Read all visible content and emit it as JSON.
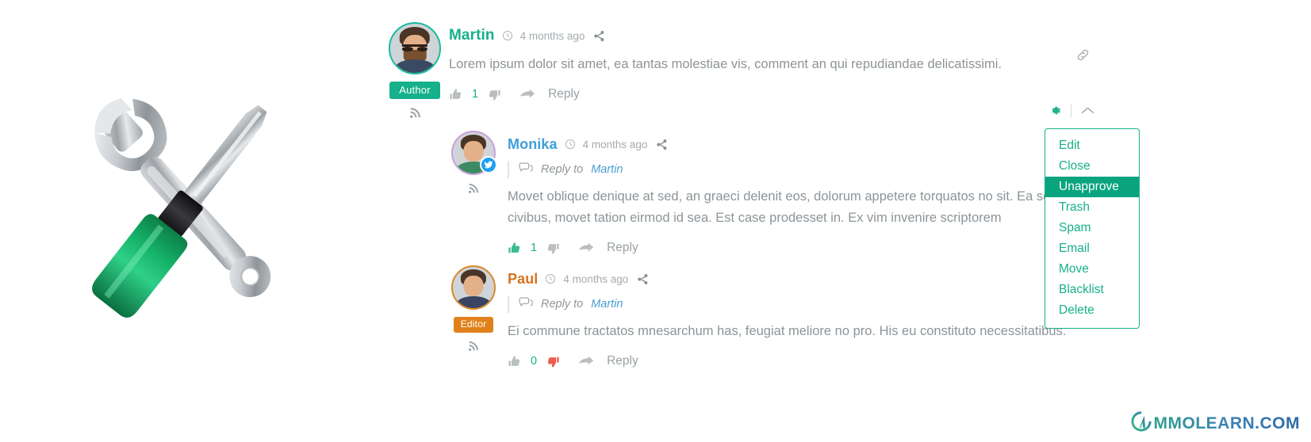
{
  "illustration": {
    "name": "tools-illustration",
    "description": "crossed wrench and screwdriver",
    "wrench_color": "#b9bec3",
    "screwdriver_handle_color": "#0f9d58"
  },
  "thread": {
    "permalink_icon": "link-icon",
    "tools": {
      "gear_icon": "gear-icon",
      "collapse_icon": "chevron-up-icon"
    },
    "comments": [
      {
        "author": "Martin",
        "author_color": "#16b08a",
        "timestamp": "4 months ago",
        "clock_icon": "clock-icon",
        "share_icon": "share-icon",
        "rss_icon": "rss-icon",
        "role_badge": "Author",
        "role_badge_color": "#16b08a",
        "avatar_ring_color": "#1abc9c",
        "social_badge": null,
        "reply_to": null,
        "reply_to_prefix": null,
        "text": "Lorem ipsum dolor sit amet, ea tantas molestiae vis, comment an qui repudiandae delicatissimi.",
        "vote_up_icon": "thumbs-up-icon",
        "vote_down_icon": "thumbs-down-icon",
        "vote_count": "1",
        "vote_up_active": false,
        "vote_down_active": false,
        "reply_arrow_icon": "reply-arrow-icon",
        "reply_label": "Reply"
      },
      {
        "author": "Monika",
        "author_color": "#3f9fd8",
        "timestamp": "4 months ago",
        "clock_icon": "clock-icon",
        "share_icon": "share-icon",
        "rss_icon": "rss-icon",
        "role_badge": null,
        "role_badge_color": null,
        "avatar_ring_color": "#c9a0dc",
        "social_badge": "twitter-icon",
        "reply_to_prefix": "Reply to",
        "reply_to": "Martin",
        "reply_to_icon": "comment-bubbles-icon",
        "text": "Movet oblique denique at sed, an graeci delenit eos, dolorum appetere torquatos no sit. Ea solum civibus, movet tation eirmod id sea. Est case prodesset in. Ex vim invenire scriptorem",
        "vote_up_icon": "thumbs-up-icon",
        "vote_down_icon": "thumbs-down-icon",
        "vote_count": "1",
        "vote_up_active": true,
        "vote_down_active": false,
        "reply_arrow_icon": "reply-arrow-icon",
        "reply_label": "Reply"
      },
      {
        "author": "Paul",
        "author_color": "#d9731e",
        "timestamp": "4 months ago",
        "clock_icon": "clock-icon",
        "share_icon": "share-icon",
        "rss_icon": "rss-icon",
        "role_badge": "Editor",
        "role_badge_color": "#e0811c",
        "avatar_ring_color": "#d8892a",
        "social_badge": null,
        "reply_to_prefix": "Reply to",
        "reply_to": "Martin",
        "reply_to_icon": "comment-bubbles-icon",
        "text": "Ei commune tractatos mnesarchum has, feugiat meliore no pro. His eu constituto necessitatibus.",
        "vote_up_icon": "thumbs-up-icon",
        "vote_down_icon": "thumbs-down-icon",
        "vote_count": "0",
        "vote_up_active": false,
        "vote_down_active": true,
        "reply_arrow_icon": "reply-arrow-icon",
        "reply_label": "Reply"
      }
    ]
  },
  "moderation_menu": {
    "border_color": "#16b08a",
    "text_color": "#17b089",
    "selected_bg": "#0aa47f",
    "selected_index": 2,
    "items": [
      {
        "label": "Edit"
      },
      {
        "label": "Close"
      },
      {
        "label": "Unapprove"
      },
      {
        "label": "Trash"
      },
      {
        "label": "Spam"
      },
      {
        "label": "Email"
      },
      {
        "label": "Move"
      },
      {
        "label": "Blacklist"
      },
      {
        "label": "Delete"
      }
    ]
  },
  "watermark": {
    "text": "MMOLEARN.COM",
    "logo_icon": "mmolearn-logo-icon"
  }
}
